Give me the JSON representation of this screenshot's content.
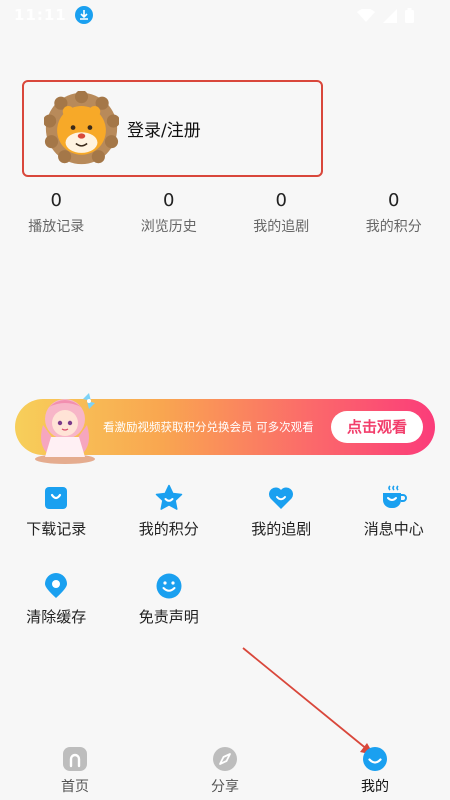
{
  "status_bar": {
    "time": "11:11",
    "download_icon": "download-icon",
    "wifi_icon": "wifi-icon",
    "signal_icon": "signal-icon",
    "battery_icon": "battery-icon"
  },
  "profile": {
    "avatar_icon": "lion-avatar-icon",
    "login_label": "登录/注册"
  },
  "stats": [
    {
      "value": "0",
      "label": "播放记录"
    },
    {
      "value": "0",
      "label": "浏览历史"
    },
    {
      "value": "0",
      "label": "我的追剧"
    },
    {
      "value": "0",
      "label": "我的积分"
    }
  ],
  "banner": {
    "text": "看激励视频获取积分兑换会员  可多次观看",
    "button_label": "点击观看",
    "colors": [
      "#f7cf5a",
      "#fb3c7a"
    ]
  },
  "grid": [
    {
      "icon": "download-record-icon",
      "label": "下载记录"
    },
    {
      "icon": "star-icon",
      "label": "我的积分"
    },
    {
      "icon": "heart-icon",
      "label": "我的追剧"
    },
    {
      "icon": "message-cup-icon",
      "label": "消息中心"
    },
    {
      "icon": "location-pin-icon",
      "label": "清除缓存"
    },
    {
      "icon": "smile-icon",
      "label": "免责声明"
    }
  ],
  "nav": [
    {
      "icon": "home-icon",
      "label": "首页"
    },
    {
      "icon": "compass-icon",
      "label": "分享"
    },
    {
      "icon": "smile-icon",
      "label": "我的",
      "active": true
    }
  ],
  "colors": {
    "accent": "#1aa0f0",
    "annotation": "#d9473b",
    "nav_inactive": "#bbbbbb"
  }
}
